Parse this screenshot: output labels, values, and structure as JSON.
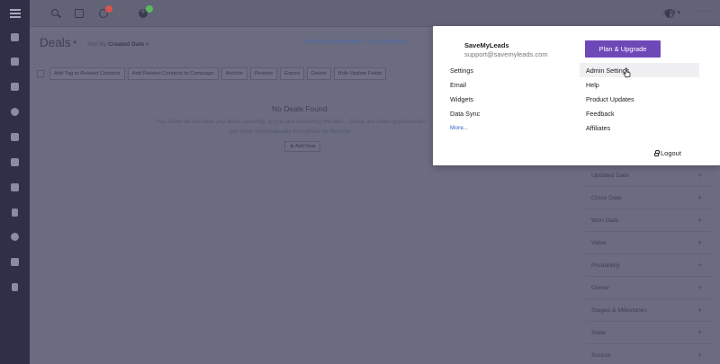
{
  "topbar": {
    "add_label": "Add",
    "notification_badge_color": "#d9534f",
    "activity_badge_color": "#5cb85c"
  },
  "deals": {
    "title": "Deals",
    "sort_by_label": "Sort By",
    "sort_by_value": "Created Date",
    "filter_link": "Send sales automation / No automation",
    "actions": [
      "Add Tag to Related Contacts",
      "Add Related Contacts to Campaign",
      "Archive",
      "Restore",
      "Export",
      "Delete",
      "Bulk Update Fields"
    ],
    "empty_title": "No Deals Found.",
    "empty_text": "You either do not have any deals currently, or you are searching the filter... Deals are sales opportunities you track systematically throughout its lifecycle.",
    "empty_button": "Add Deal"
  },
  "filters": [
    "Updated Date",
    "Close Date",
    "Won Date",
    "Value",
    "Probability",
    "Owner",
    "Stages & Milestones",
    "State",
    "Source"
  ],
  "account_menu": {
    "name": "SaveMyLeads",
    "email": "support@savemyleads.com",
    "plan_button": "Plan & Upgrade",
    "left_items": [
      "Settings",
      "Email",
      "Widgets",
      "Data Sync",
      "More..."
    ],
    "right_items": [
      "Admin Settings",
      "Help",
      "Product Updates",
      "Feedback",
      "Affiliates"
    ],
    "logout": "Logout",
    "accent_color": "#6f48b8"
  }
}
